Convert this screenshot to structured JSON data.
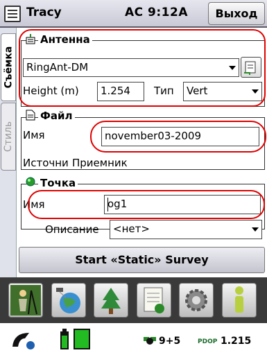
{
  "titlebar": {
    "title": "Tracy",
    "clock": "AC  9:12A",
    "exit_label": "Выход"
  },
  "tabs": [
    {
      "label": "Съёмка",
      "active": true
    },
    {
      "label": "Стиль",
      "active": false
    }
  ],
  "antenna": {
    "section_title": "Антенна",
    "model": "RingAnt-DM",
    "height_label": "Height (m)",
    "height_value": "1.254",
    "type_label": "Тип",
    "type_value": "Vert"
  },
  "file": {
    "section_title": "Файл",
    "name_label": "Имя",
    "name_value": "november03-2009",
    "source_label": "Источни",
    "source_value": "Приемник"
  },
  "point": {
    "section_title": "Точка",
    "name_label": "Имя",
    "name_value": "og1",
    "desc_label": "Описание",
    "desc_value": "<нет>"
  },
  "start_button": "Start «Static» Survey",
  "toolbar": [
    {
      "icon": "surveyor-icon"
    },
    {
      "icon": "globe-satellite-icon"
    },
    {
      "icon": "tree-icon"
    },
    {
      "icon": "notebook-icon"
    },
    {
      "icon": "gear-icon"
    },
    {
      "icon": "info-icon"
    }
  ],
  "status": {
    "satellites": "9+5",
    "pdop_label": "PDOP",
    "pdop_value": "1.215"
  },
  "colors": {
    "highlight": "#e00000",
    "toolbar_bg": "#3a3a3a",
    "battery": "#22bb22"
  }
}
